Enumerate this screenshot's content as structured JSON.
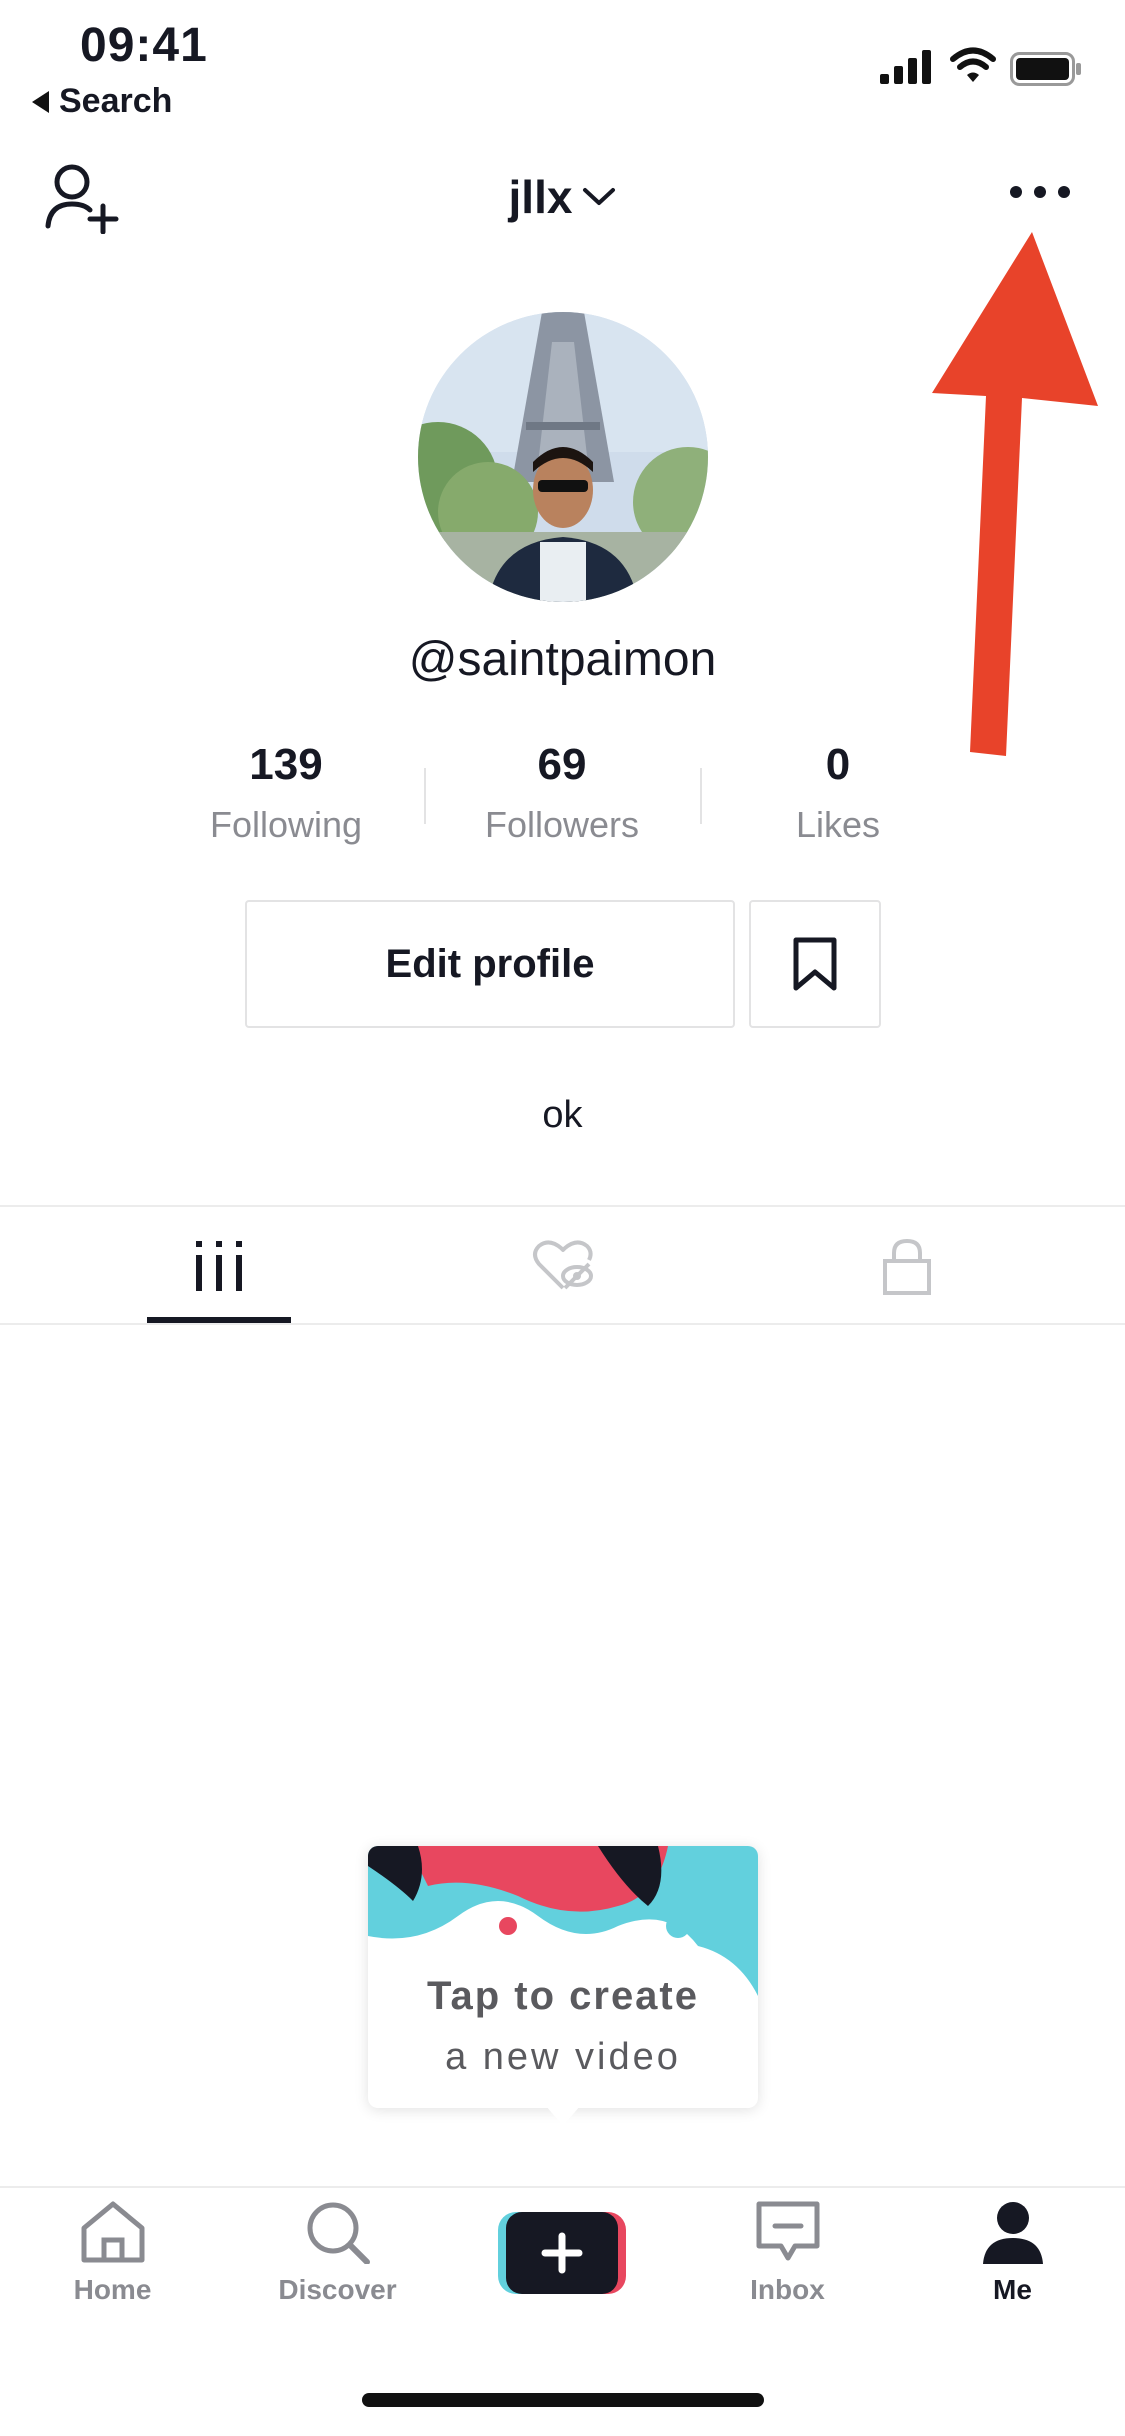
{
  "status_bar": {
    "time": "09:41",
    "back_label": "Search"
  },
  "header": {
    "username": "jllx"
  },
  "profile": {
    "handle": "@saintpaimon",
    "stats": [
      {
        "value": "139",
        "label": "Following"
      },
      {
        "value": "69",
        "label": "Followers"
      },
      {
        "value": "0",
        "label": "Likes"
      }
    ],
    "edit_label": "Edit profile",
    "bio": "ok"
  },
  "tooltip": {
    "line1": "Tap to create",
    "line2": "a new video"
  },
  "nav": {
    "items": [
      {
        "label": "Home",
        "icon": "home-icon"
      },
      {
        "label": "Discover",
        "icon": "search-icon"
      },
      {
        "label": "",
        "icon": "plus-icon"
      },
      {
        "label": "Inbox",
        "icon": "inbox-icon"
      },
      {
        "label": "Me",
        "icon": "person-icon"
      }
    ]
  },
  "colors": {
    "annotation_arrow": "#e8432a",
    "accent_pink": "#e8475f",
    "accent_cyan": "#62d0dd",
    "text": "#161823"
  }
}
